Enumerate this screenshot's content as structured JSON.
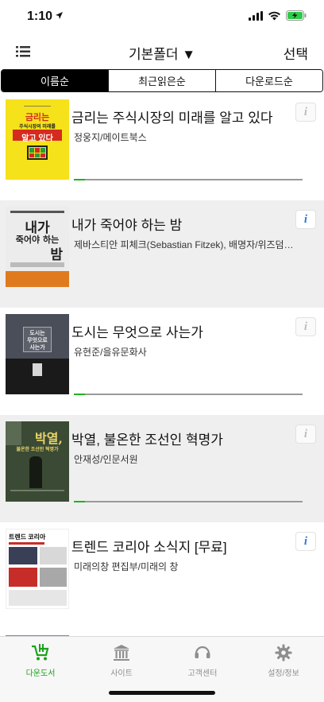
{
  "status": {
    "time": "1:10"
  },
  "header": {
    "folder_title": "기본폴더 ▼",
    "select_label": "선택"
  },
  "sort_tabs": [
    {
      "label": "이름순",
      "active": true
    },
    {
      "label": "최근읽은순",
      "active": false
    },
    {
      "label": "다운로드순",
      "active": false
    }
  ],
  "books": [
    {
      "title": "금리는 주식시장의 미래를 알고 있다",
      "author": "정웅지/메이트북스",
      "info_icon": "info-icon",
      "progress": 0.05,
      "cover": {
        "top_text": "금리는",
        "mid_text": "주식시장의 미래를",
        "bottom_text": "알고 있다",
        "bg": "#f5e21a",
        "accent": "#d42b1e"
      }
    },
    {
      "title": "내가 죽어야 하는 밤",
      "author": "제바스티안 피체크(Sebastian Fitzek), 배명자/위즈덤하우스",
      "info_icon": "info-icon",
      "cover": {
        "top_text": "내가",
        "mid_text": "죽어야 하는",
        "bottom_text": "밤",
        "bg": "#ececec",
        "accent": "#e07a1f"
      }
    },
    {
      "title": "도시는 무엇으로 사는가",
      "author": "유현준/을유문화사",
      "info_icon": "info-icon",
      "progress": 0.05,
      "cover": {
        "top_text": "도시는",
        "mid_text": "무엇으로",
        "bottom_text": "사는가",
        "bg": "#4a4e58",
        "accent": "#1a1a1a"
      }
    },
    {
      "title": "박열, 불온한 조선인 혁명가",
      "author": "안재성/인문서원",
      "info_icon": "info-icon",
      "progress": 0.05,
      "cover": {
        "top_text": "박열,",
        "mid_text": "불온한 조선인 혁명가",
        "bottom_text": "",
        "bg": "#3b4a34",
        "accent": "#e8d46a"
      }
    },
    {
      "title": "트렌드 코리아 소식지 [무료]",
      "author": "미래의창 편집부/미래의 창",
      "info_icon": "info-icon",
      "cover": {
        "top_text": "트렌드 코리아",
        "mid_text": "",
        "bottom_text": "",
        "bg": "#ffffff",
        "accent": "#c62d28"
      }
    }
  ],
  "tab_bar": [
    {
      "label": "다운도서",
      "icon": "download-cart-icon",
      "active": true
    },
    {
      "label": "사이트",
      "icon": "bank-building-icon",
      "active": false
    },
    {
      "label": "고객센터",
      "icon": "headset-icon",
      "active": false
    },
    {
      "label": "설정/정보",
      "icon": "gear-icon",
      "active": false
    }
  ],
  "colors": {
    "accent_green": "#1aa31a",
    "info_blue": "#2f7ad8",
    "alt_row": "#efefef"
  }
}
